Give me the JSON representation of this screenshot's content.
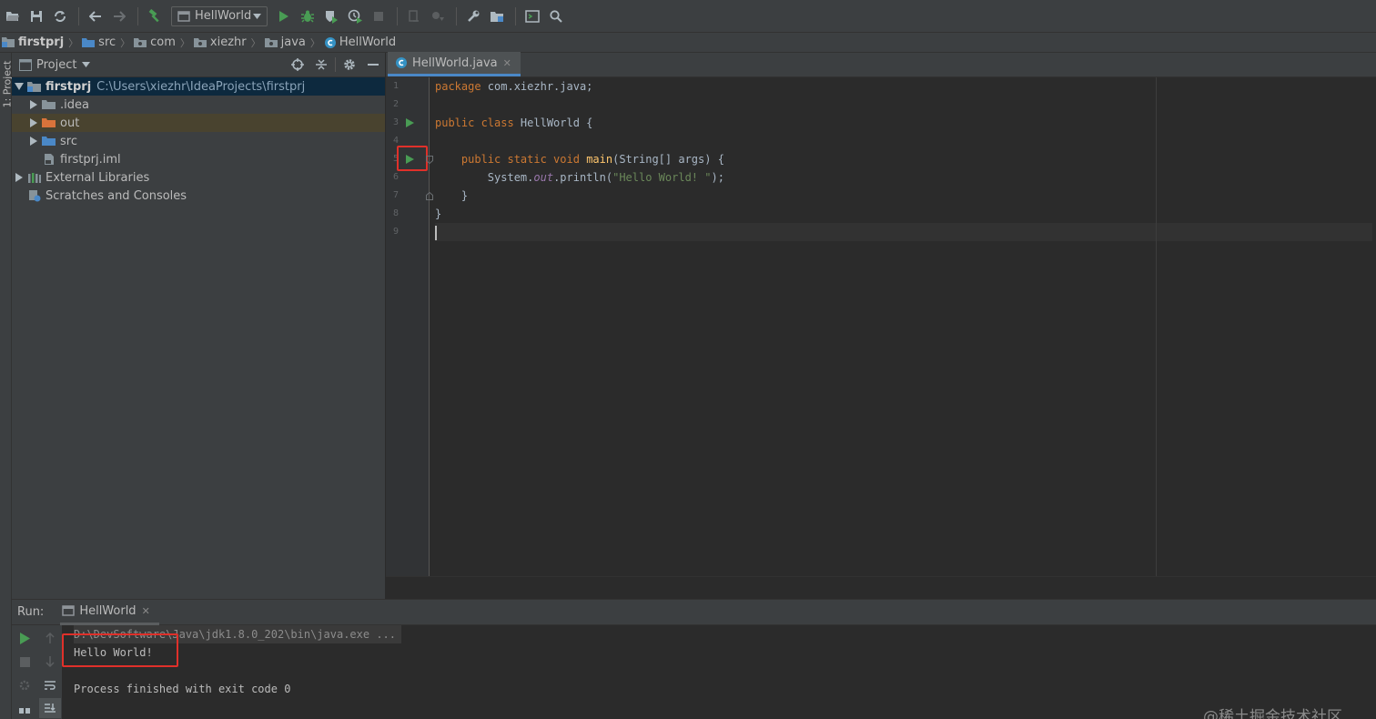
{
  "toolbar": {
    "run_config": "HellWorld",
    "icons": [
      "open-icon",
      "save-icon",
      "sync-icon",
      "back-icon",
      "forward-icon",
      "build-icon",
      "run-icon",
      "debug-icon",
      "coverage-icon",
      "profile-icon",
      "stop-icon",
      "vcs-icon",
      "vcs-update-icon",
      "settings-icon",
      "project-structure-icon",
      "terminal-icon",
      "search-icon"
    ]
  },
  "breadcrumb": [
    {
      "label": "firstprj",
      "icon": "project-icon"
    },
    {
      "label": "src",
      "icon": "folder-icon"
    },
    {
      "label": "com",
      "icon": "package-icon"
    },
    {
      "label": "xiezhr",
      "icon": "package-icon"
    },
    {
      "label": "java",
      "icon": "package-icon"
    },
    {
      "label": "HellWorld",
      "icon": "class-icon"
    }
  ],
  "left_strip": {
    "project_tab": "1: Project"
  },
  "project_panel": {
    "title": "Project",
    "tree": {
      "root_name": "firstprj",
      "root_path": "C:\\Users\\xiezhr\\IdeaProjects\\firstprj",
      "idea": ".idea",
      "out": "out",
      "src": "src",
      "iml": "firstprj.iml",
      "libs": "External Libraries",
      "scratches": "Scratches and Consoles"
    }
  },
  "editor": {
    "tab_label": "HellWorld.java",
    "line_numbers": [
      "1",
      "2",
      "3",
      "4",
      "5",
      "6",
      "7",
      "8",
      "9"
    ],
    "code": {
      "l1_kw": "package",
      "l1_rest": " com.xiezhr.java;",
      "l3_kw": "public class",
      "l3_rest": " HellWorld {",
      "l5_indent": "    ",
      "l5_kw": "public static void",
      "l5_fn": "main",
      "l5_rest": "(String[] args) {",
      "l6_a": "        System.",
      "l6_fld": "out",
      "l6_b": ".println(",
      "l6_str": "\"Hello World! \"",
      "l6_c": ");",
      "l7": "    }",
      "l8": "}"
    }
  },
  "run_panel": {
    "label": "Run:",
    "tab_label": "HellWorld",
    "console": {
      "cmd": "D:\\DevSoftware\\Java\\jdk1.8.0_202\\bin\\java.exe ...",
      "output": "Hello World!",
      "blank": "",
      "finished": "Process finished with exit code 0"
    }
  },
  "watermark": "@稀土掘金技术社区",
  "colors": {
    "accent": "#4a88c7",
    "highlight": "#e0302a",
    "run_green": "#499c54"
  }
}
